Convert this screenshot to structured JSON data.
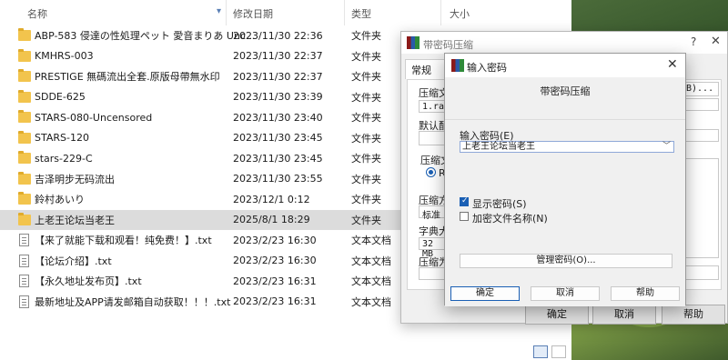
{
  "explorer": {
    "columns": {
      "name": "名称",
      "modified": "修改日期",
      "type": "类型",
      "size": "大小"
    },
    "rows": [
      {
        "kind": "folder",
        "name": "ABP-583 侵達の性処理ペット 愛音まりあ Unc...",
        "date": "2023/11/30 22:36",
        "type": "文件夹"
      },
      {
        "kind": "folder",
        "name": "KMHRS-003",
        "date": "2023/11/30 22:37",
        "type": "文件夹"
      },
      {
        "kind": "folder",
        "name": "PRESTIGE 無碼流出全套.原版母帶無水印",
        "date": "2023/11/30 22:37",
        "type": "文件夹"
      },
      {
        "kind": "folder",
        "name": "SDDE-625",
        "date": "2023/11/30 23:39",
        "type": "文件夹"
      },
      {
        "kind": "folder",
        "name": "STARS-080-Uncensored",
        "date": "2023/11/30 23:40",
        "type": "文件夹"
      },
      {
        "kind": "folder",
        "name": "STARS-120",
        "date": "2023/11/30 23:45",
        "type": "文件夹"
      },
      {
        "kind": "folder",
        "name": "stars-229-C",
        "date": "2023/11/30 23:45",
        "type": "文件夹"
      },
      {
        "kind": "folder",
        "name": "吉泽明步无码流出",
        "date": "2023/11/30 23:55",
        "type": "文件夹"
      },
      {
        "kind": "folder",
        "name": "鈴村あいり",
        "date": "2023/12/1 0:12",
        "type": "文件夹"
      },
      {
        "kind": "folder",
        "name": "上老王论坛当老王",
        "date": "2025/8/1 18:29",
        "type": "文件夹",
        "selected": true
      },
      {
        "kind": "txt",
        "name": "【来了就能下载和观看！纯免费！】.txt",
        "date": "2023/2/23 16:30",
        "type": "文本文档"
      },
      {
        "kind": "txt",
        "name": "【论坛介绍】.txt",
        "date": "2023/2/23 16:30",
        "type": "文本文档"
      },
      {
        "kind": "txt",
        "name": "【永久地址发布页】.txt",
        "date": "2023/2/23 16:31",
        "type": "文本文档"
      },
      {
        "kind": "txt",
        "name": "最新地址及APP请发邮箱自动获取！！！.txt",
        "date": "2023/2/23 16:31",
        "type": "文本文档"
      }
    ]
  },
  "back_dialog": {
    "title": "带密码压缩",
    "help_glyph": "?",
    "close_glyph": "✕",
    "tab_general": "常规",
    "label_archive": "压缩文",
    "archive_value": "1.rar",
    "browse_partial": "B)...",
    "label_profile": "默认配",
    "label_format": "压缩文",
    "radio_partial": "RA",
    "label_method": "压缩方",
    "method_value": "标准",
    "label_dict": "字典大",
    "dict_value": "32 MB",
    "label_split": "压缩为",
    "ok": "确定",
    "cancel": "取消",
    "help": "帮助"
  },
  "password_dialog": {
    "title": "输入密码",
    "close_glyph": "✕",
    "subtitle": "带密码压缩",
    "label_password": "输入密码(E)",
    "password_value": "上老王论坛当老王",
    "dropdown_arrow": "﹀",
    "show_password": {
      "label": "显示密码(S)",
      "checked": true
    },
    "encrypt_names": {
      "label": "加密文件名称(N)",
      "checked": false
    },
    "manage": "管理密码(O)...",
    "ok": "确定",
    "cancel": "取消",
    "help": "帮助"
  }
}
